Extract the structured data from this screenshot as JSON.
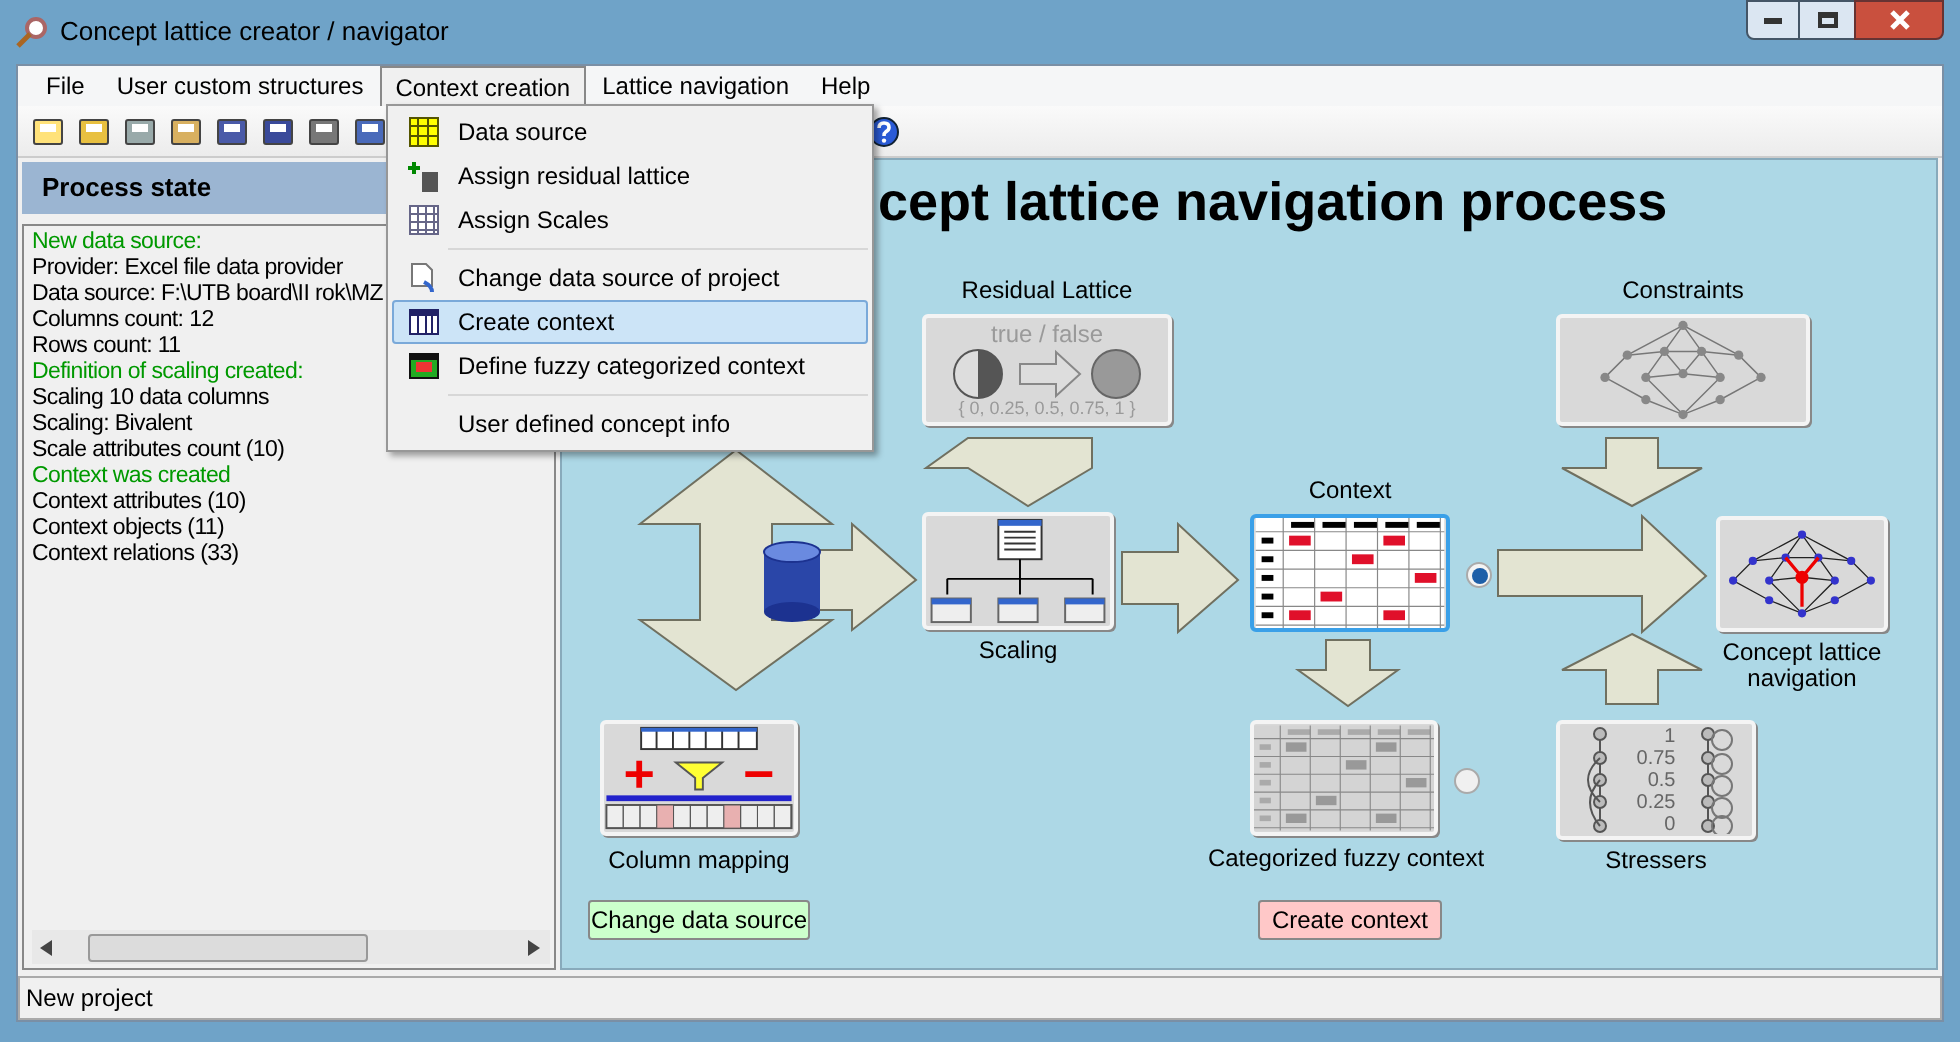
{
  "window": {
    "title": "Concept lattice creator / navigator"
  },
  "menu_bar": [
    {
      "label": "File",
      "selected": false
    },
    {
      "label": "User custom structures",
      "selected": false
    },
    {
      "label": "Context creation",
      "selected": true
    },
    {
      "label": "Lattice navigation",
      "selected": false
    },
    {
      "label": "Help",
      "selected": false
    }
  ],
  "context_menu": {
    "groups": [
      [
        {
          "label": "Data source",
          "selected": false
        },
        {
          "label": "Assign residual lattice",
          "selected": false
        },
        {
          "label": "Assign Scales",
          "selected": false
        }
      ],
      [
        {
          "label": "Change data source of project",
          "selected": false
        },
        {
          "label": "Create context",
          "selected": true
        },
        {
          "label": "Define fuzzy categorized context",
          "selected": false
        }
      ],
      [
        {
          "label": "User defined concept info",
          "selected": false
        }
      ]
    ]
  },
  "process_state": {
    "title": "Process state",
    "log": [
      {
        "text": "New data source:",
        "kind": "heading"
      },
      {
        "text": "Provider: Excel file data provider",
        "kind": "line"
      },
      {
        "text": "Data source: F:\\UTB board\\II rok\\MZ",
        "kind": "line"
      },
      {
        "text": "Columns count: 12",
        "kind": "line"
      },
      {
        "text": "Rows count: 11",
        "kind": "line"
      },
      {
        "text": "Definition of scaling created:",
        "kind": "heading"
      },
      {
        "text": "Scaling 10 data columns",
        "kind": "line"
      },
      {
        "text": "Scaling: Bivalent",
        "kind": "line"
      },
      {
        "text": "Scale attributes count (10)",
        "kind": "line"
      },
      {
        "text": "Context was created",
        "kind": "heading"
      },
      {
        "text": "Context attributes (10)",
        "kind": "line"
      },
      {
        "text": "Context objects (11)",
        "kind": "line"
      },
      {
        "text": "Context relations (33)",
        "kind": "line"
      }
    ]
  },
  "diagram": {
    "title": "cept lattice navigation process",
    "nodes": [
      {
        "kind": "residual",
        "label": "Residual Lattice",
        "tile_texts": [
          "true / false",
          "{ 0, 0.25, 0.5, 0.75, 1 }"
        ]
      },
      {
        "kind": "constraints",
        "label": "Constraints"
      },
      {
        "kind": "context",
        "label": "Context",
        "selected": true,
        "radio_selected": true
      },
      {
        "kind": "scaling",
        "label": "Scaling"
      },
      {
        "kind": "navigation",
        "label": "Concept lattice navigation"
      },
      {
        "kind": "mapping",
        "label": "Column mapping"
      },
      {
        "kind": "fuzzy",
        "label": "Categorized fuzzy context",
        "selected": false,
        "radio_selected": false
      },
      {
        "kind": "stressers",
        "label": "Stressers",
        "tile_texts": [
          "1",
          "0.75",
          "0.5",
          "0.25",
          "0"
        ]
      }
    ],
    "buttons": [
      {
        "kind": "mapping",
        "label": "Change data source",
        "color": "#ccffcc"
      },
      {
        "kind": "fuzzy",
        "label": "Create context",
        "color": "#ffc8c8"
      }
    ]
  },
  "status_bar": {
    "text": "New project"
  }
}
